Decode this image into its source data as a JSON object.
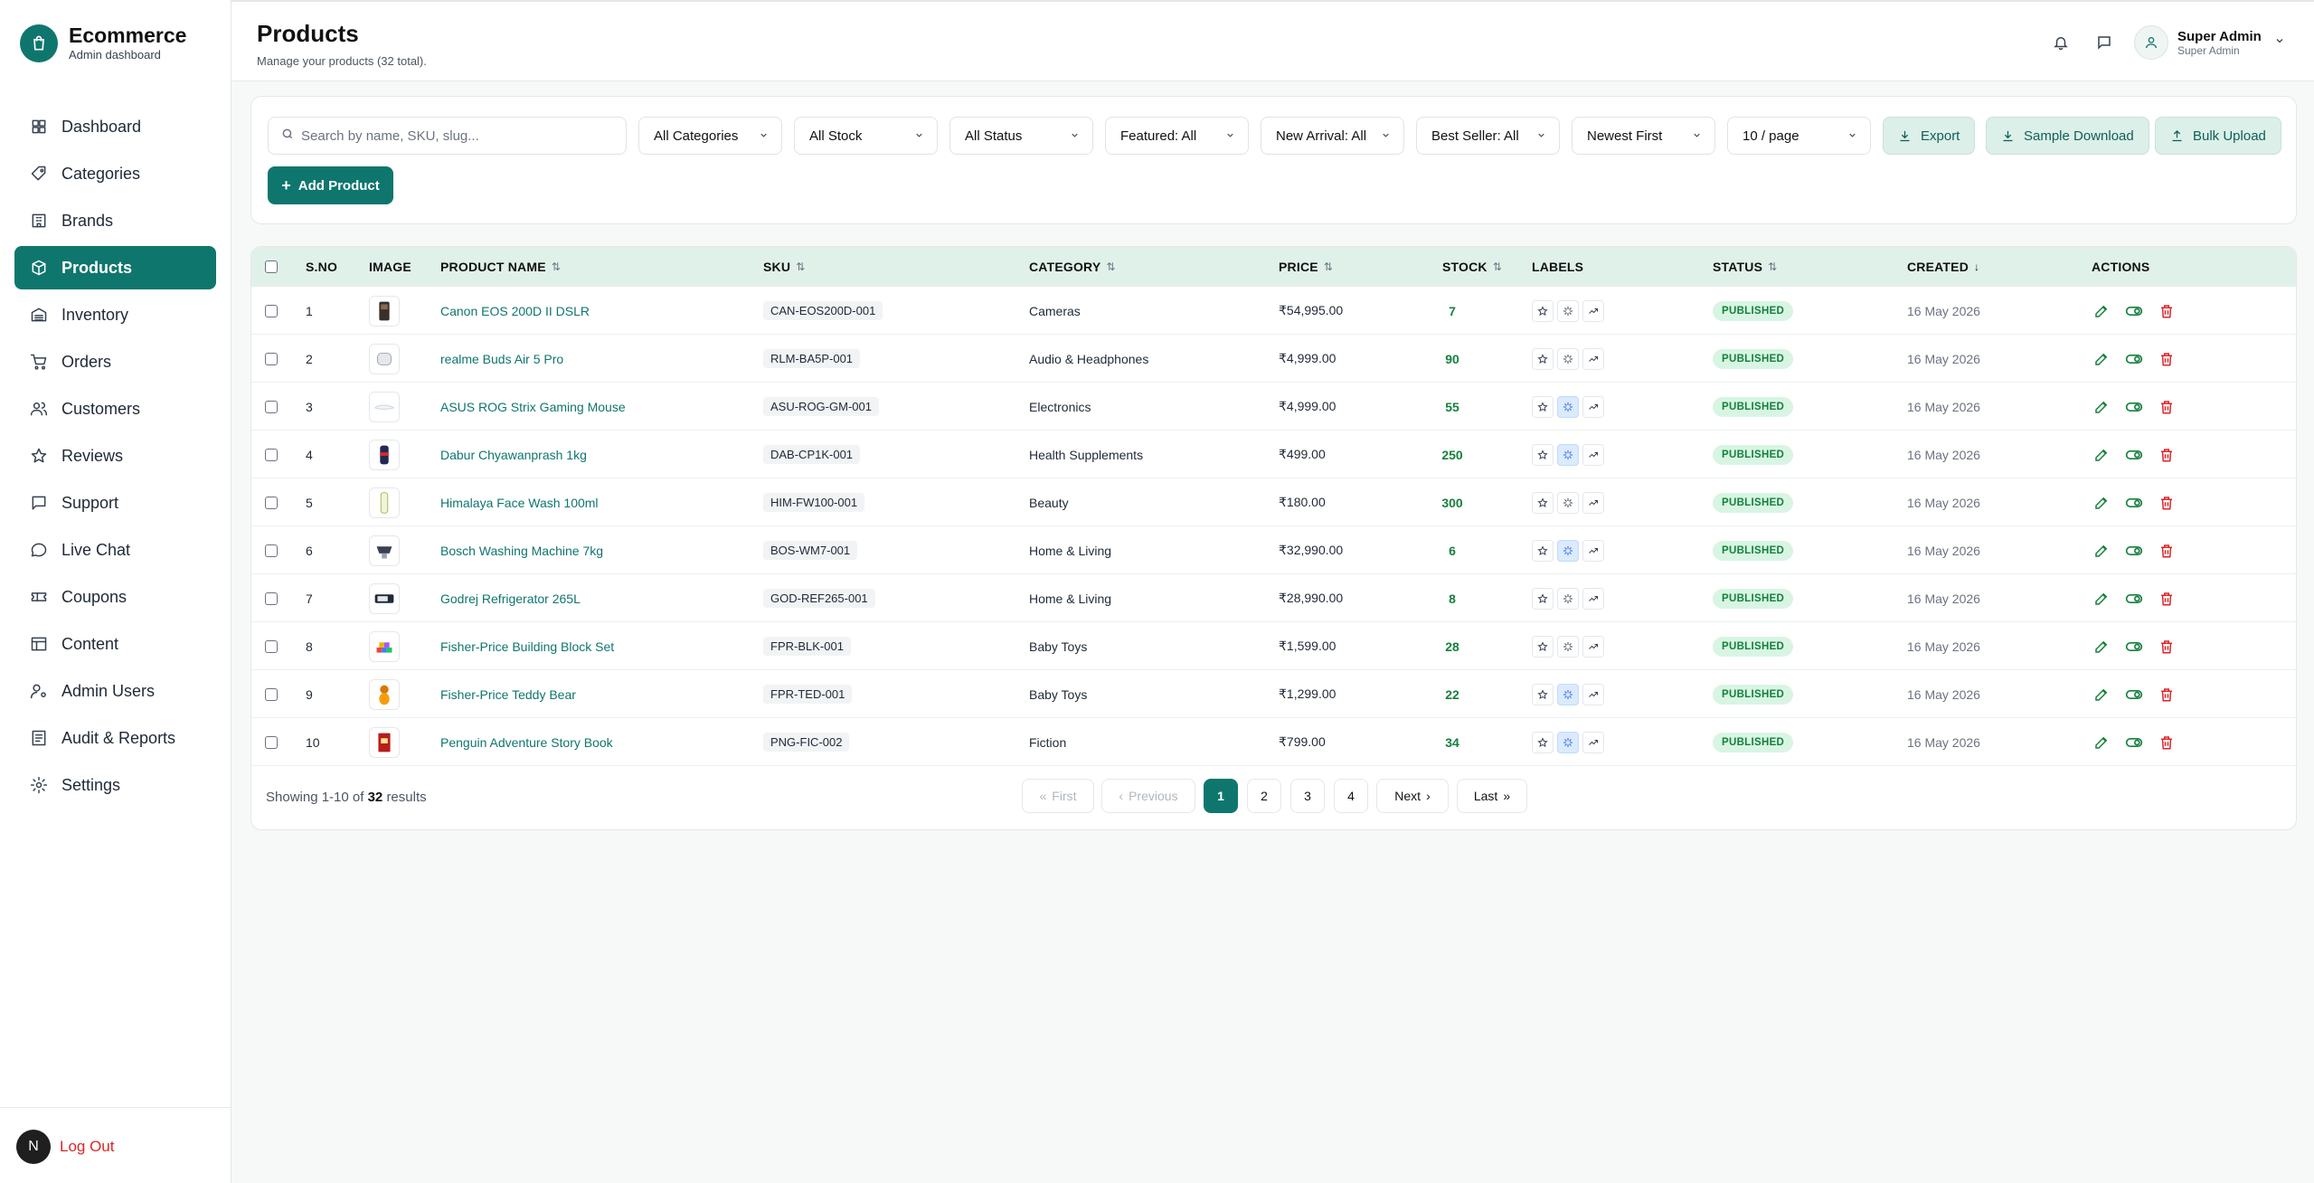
{
  "brand": {
    "title": "Ecommerce",
    "subtitle": "Admin dashboard"
  },
  "sidebar": {
    "items": [
      {
        "label": "Dashboard",
        "icon": "dashboard-icon"
      },
      {
        "label": "Categories",
        "icon": "tag-icon"
      },
      {
        "label": "Brands",
        "icon": "building-icon"
      },
      {
        "label": "Products",
        "icon": "box-icon",
        "active": true
      },
      {
        "label": "Inventory",
        "icon": "warehouse-icon"
      },
      {
        "label": "Orders",
        "icon": "cart-icon"
      },
      {
        "label": "Customers",
        "icon": "users-icon"
      },
      {
        "label": "Reviews",
        "icon": "star-icon"
      },
      {
        "label": "Support",
        "icon": "message-square-icon"
      },
      {
        "label": "Live Chat",
        "icon": "chat-bubble-icon"
      },
      {
        "label": "Coupons",
        "icon": "ticket-icon"
      },
      {
        "label": "Content",
        "icon": "layout-icon"
      },
      {
        "label": "Admin Users",
        "icon": "user-cog-icon"
      },
      {
        "label": "Audit & Reports",
        "icon": "report-icon"
      },
      {
        "label": "Settings",
        "icon": "gear-icon"
      }
    ],
    "logout_label": "Log Out",
    "logout_avatar": "N"
  },
  "header": {
    "title": "Products",
    "subtitle": "Manage your products (32 total).",
    "user_name": "Super Admin",
    "user_role": "Super Admin"
  },
  "filters": {
    "search_placeholder": "Search by name, SKU, slug...",
    "selects": [
      "All Categories",
      "All Stock",
      "All Status",
      "Featured: All",
      "New Arrival: All",
      "Best Seller: All",
      "Newest First",
      "10 / page"
    ],
    "export_label": "Export",
    "sample_label": "Sample Download",
    "bulk_label": "Bulk Upload",
    "add_label": "Add Product"
  },
  "table": {
    "headers": {
      "sno": "S.NO",
      "image": "IMAGE",
      "name": "PRODUCT NAME",
      "sku": "SKU",
      "category": "CATEGORY",
      "price": "PRICE",
      "stock": "STOCK",
      "labels": "LABELS",
      "status": "STATUS",
      "created": "CREATED",
      "actions": "ACTIONS"
    },
    "rows": [
      {
        "sno": "1",
        "name": "Canon EOS 200D II DSLR",
        "sku": "CAN-EOS200D-001",
        "category": "Cameras",
        "price": "₹54,995.00",
        "stock": "7",
        "new_arrival": false,
        "status": "PUBLISHED",
        "created": "16 May 2026",
        "thumb": "camera"
      },
      {
        "sno": "2",
        "name": "realme Buds Air 5 Pro",
        "sku": "RLM-BA5P-001",
        "category": "Audio & Headphones",
        "price": "₹4,999.00",
        "stock": "90",
        "new_arrival": false,
        "status": "PUBLISHED",
        "created": "16 May 2026",
        "thumb": "buds"
      },
      {
        "sno": "3",
        "name": "ASUS ROG Strix Gaming Mouse",
        "sku": "ASU-ROG-GM-001",
        "category": "Electronics",
        "price": "₹4,999.00",
        "stock": "55",
        "new_arrival": true,
        "status": "PUBLISHED",
        "created": "16 May 2026",
        "thumb": "mouse"
      },
      {
        "sno": "4",
        "name": "Dabur Chyawanprash 1kg",
        "sku": "DAB-CP1K-001",
        "category": "Health Supplements",
        "price": "₹499.00",
        "stock": "250",
        "new_arrival": true,
        "status": "PUBLISHED",
        "created": "16 May 2026",
        "thumb": "jar"
      },
      {
        "sno": "5",
        "name": "Himalaya Face Wash 100ml",
        "sku": "HIM-FW100-001",
        "category": "Beauty",
        "price": "₹180.00",
        "stock": "300",
        "new_arrival": false,
        "status": "PUBLISHED",
        "created": "16 May 2026",
        "thumb": "tube"
      },
      {
        "sno": "6",
        "name": "Bosch Washing Machine 7kg",
        "sku": "BOS-WM7-001",
        "category": "Home & Living",
        "price": "₹32,990.00",
        "stock": "6",
        "new_arrival": true,
        "status": "PUBLISHED",
        "created": "16 May 2026",
        "thumb": "washer"
      },
      {
        "sno": "7",
        "name": "Godrej Refrigerator 265L",
        "sku": "GOD-REF265-001",
        "category": "Home & Living",
        "price": "₹28,990.00",
        "stock": "8",
        "new_arrival": false,
        "status": "PUBLISHED",
        "created": "16 May 2026",
        "thumb": "fridge"
      },
      {
        "sno": "8",
        "name": "Fisher-Price Building Block Set",
        "sku": "FPR-BLK-001",
        "category": "Baby Toys",
        "price": "₹1,599.00",
        "stock": "28",
        "new_arrival": false,
        "status": "PUBLISHED",
        "created": "16 May 2026",
        "thumb": "blocks"
      },
      {
        "sno": "9",
        "name": "Fisher-Price Teddy Bear",
        "sku": "FPR-TED-001",
        "category": "Baby Toys",
        "price": "₹1,299.00",
        "stock": "22",
        "new_arrival": true,
        "status": "PUBLISHED",
        "created": "16 May 2026",
        "thumb": "teddy"
      },
      {
        "sno": "10",
        "name": "Penguin Adventure Story Book",
        "sku": "PNG-FIC-002",
        "category": "Fiction",
        "price": "₹799.00",
        "stock": "34",
        "new_arrival": true,
        "status": "PUBLISHED",
        "created": "16 May 2026",
        "thumb": "book"
      }
    ]
  },
  "pagination": {
    "showing_prefix": "Showing 1-10 of",
    "total": "32",
    "showing_suffix": "results",
    "first": "First",
    "previous": "Previous",
    "pages": [
      "1",
      "2",
      "3",
      "4"
    ],
    "current": "1",
    "next": "Next",
    "last": "Last"
  },
  "colors": {
    "brand": "#0f766e",
    "header_row": "#e0f1ea",
    "published_bg": "#d8f5e3",
    "published_text": "#15803d",
    "danger": "#dc2626"
  }
}
